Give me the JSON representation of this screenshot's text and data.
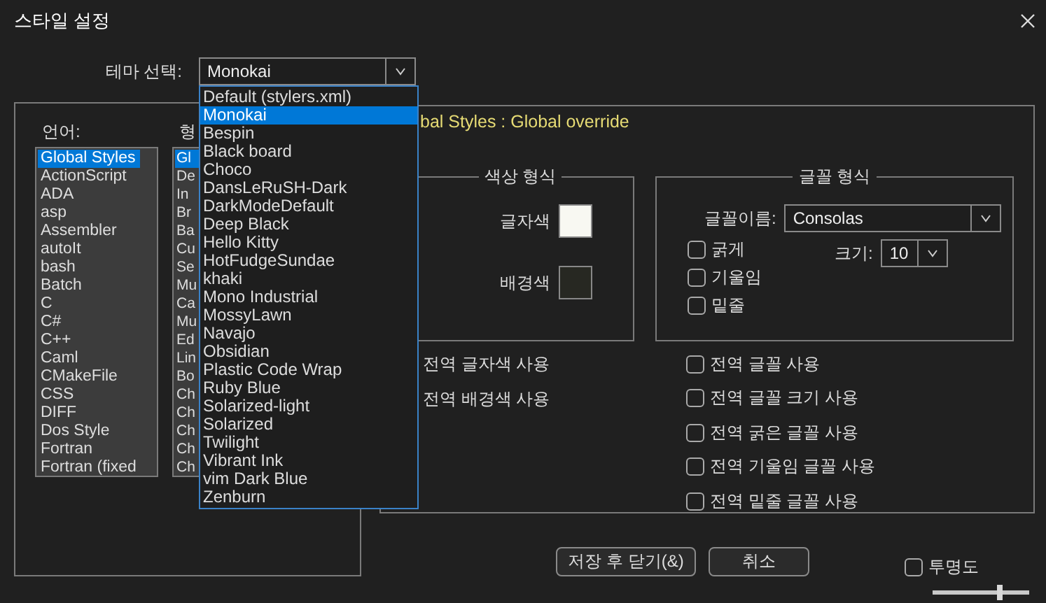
{
  "window": {
    "title": "스타일 설정"
  },
  "theme": {
    "label": "테마 선택:",
    "value": "Monokai",
    "expanded": true,
    "options": [
      {
        "label": "Default (stylers.xml)",
        "selected": false
      },
      {
        "label": "Monokai",
        "selected": true
      },
      {
        "label": "Bespin",
        "selected": false
      },
      {
        "label": "Black board",
        "selected": false
      },
      {
        "label": "Choco",
        "selected": false
      },
      {
        "label": "DansLeRuSH-Dark",
        "selected": false
      },
      {
        "label": "DarkModeDefault",
        "selected": false
      },
      {
        "label": "Deep Black",
        "selected": false
      },
      {
        "label": "Hello Kitty",
        "selected": false
      },
      {
        "label": "HotFudgeSundae",
        "selected": false
      },
      {
        "label": "khaki",
        "selected": false
      },
      {
        "label": "Mono Industrial",
        "selected": false
      },
      {
        "label": "MossyLawn",
        "selected": false
      },
      {
        "label": "Navajo",
        "selected": false
      },
      {
        "label": "Obsidian",
        "selected": false
      },
      {
        "label": "Plastic Code Wrap",
        "selected": false
      },
      {
        "label": "Ruby Blue",
        "selected": false
      },
      {
        "label": "Solarized-light",
        "selected": false
      },
      {
        "label": "Solarized",
        "selected": false
      },
      {
        "label": "Twilight",
        "selected": false
      },
      {
        "label": "Vibrant Ink",
        "selected": false
      },
      {
        "label": "vim Dark Blue",
        "selected": false
      },
      {
        "label": "Zenburn",
        "selected": false
      }
    ]
  },
  "languages": {
    "label": "언어:",
    "items": [
      {
        "label": "Global Styles",
        "selected": true
      },
      {
        "label": "ActionScript",
        "selected": false
      },
      {
        "label": "ADA",
        "selected": false
      },
      {
        "label": "asp",
        "selected": false
      },
      {
        "label": "Assembler",
        "selected": false
      },
      {
        "label": "autoIt",
        "selected": false
      },
      {
        "label": "bash",
        "selected": false
      },
      {
        "label": "Batch",
        "selected": false
      },
      {
        "label": "C",
        "selected": false
      },
      {
        "label": "C#",
        "selected": false
      },
      {
        "label": "C++",
        "selected": false
      },
      {
        "label": "Caml",
        "selected": false
      },
      {
        "label": "CMakeFile",
        "selected": false
      },
      {
        "label": "CSS",
        "selected": false
      },
      {
        "label": "DIFF",
        "selected": false
      },
      {
        "label": "Dos Style",
        "selected": false
      },
      {
        "label": "Fortran",
        "selected": false
      },
      {
        "label": "Fortran (fixed",
        "selected": false
      }
    ]
  },
  "styles": {
    "label": "형",
    "items": [
      {
        "label": "Gl",
        "selected": true
      },
      {
        "label": "De",
        "selected": false
      },
      {
        "label": "In",
        "selected": false
      },
      {
        "label": "Br",
        "selected": false
      },
      {
        "label": "Ba",
        "selected": false
      },
      {
        "label": "Cu",
        "selected": false
      },
      {
        "label": "Se",
        "selected": false
      },
      {
        "label": "Mu",
        "selected": false
      },
      {
        "label": "Ca",
        "selected": false
      },
      {
        "label": "Mu",
        "selected": false
      },
      {
        "label": "Ed",
        "selected": false
      },
      {
        "label": "Lin",
        "selected": false
      },
      {
        "label": "Bo",
        "selected": false
      },
      {
        "label": "Ch",
        "selected": false
      },
      {
        "label": "Ch",
        "selected": false
      },
      {
        "label": "Ch",
        "selected": false
      },
      {
        "label": "Ch",
        "selected": false
      },
      {
        "label": "Ch",
        "selected": false
      }
    ]
  },
  "style_title": "bal Styles : Global override",
  "color_group": {
    "title": "색상 형식",
    "swatches": [
      {
        "label": "글자색",
        "color": "#f8f8f2"
      },
      {
        "label": "배경색",
        "color": "#272822"
      }
    ]
  },
  "font_group": {
    "title": "글꼴 형식",
    "name_label": "글꼴이름:",
    "name_value": "Consolas",
    "size_label": "크기:",
    "size_value": "10",
    "options": [
      {
        "label": "굵게",
        "checked": false
      },
      {
        "label": "기울임",
        "checked": false
      },
      {
        "label": "밑줄",
        "checked": false
      }
    ]
  },
  "global_color_options": [
    "전역 글자색 사용",
    "전역 배경색 사용"
  ],
  "global_font_options": [
    {
      "label": "전역 글꼴 사용",
      "checked": false
    },
    {
      "label": "전역 글꼴 크기 사용",
      "checked": false
    },
    {
      "label": "전역 굵은 글꼴 사용",
      "checked": false
    },
    {
      "label": "전역 기울임 글꼴 사용",
      "checked": false
    },
    {
      "label": "전역 밑줄 글꼴 사용",
      "checked": false
    }
  ],
  "buttons": [
    "저장 후 닫기(&)",
    "취소"
  ],
  "transparency": {
    "label": "투명도",
    "checked": false,
    "level": 0.7
  }
}
